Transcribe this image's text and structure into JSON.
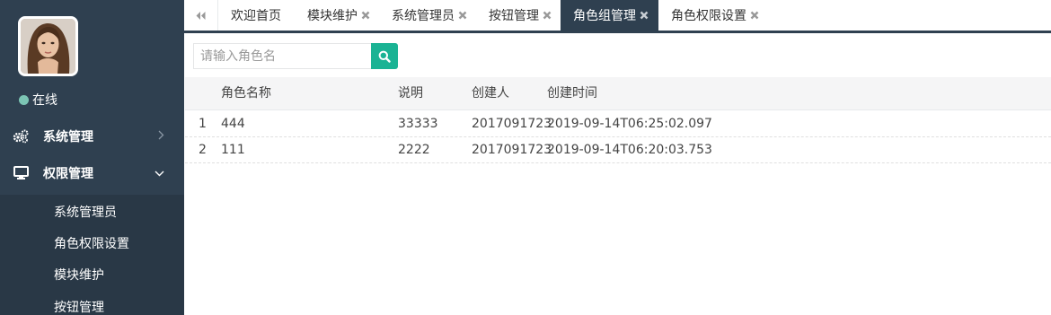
{
  "sidebar": {
    "status": "在线",
    "menu": [
      {
        "label": "系统管理",
        "icon": "cogs-icon"
      },
      {
        "label": "权限管理",
        "icon": "desktop-icon"
      }
    ],
    "submenu": [
      "系统管理员",
      "角色权限设置",
      "模块维护",
      "按钮管理"
    ]
  },
  "tabs": [
    {
      "label": "欢迎首页",
      "closable": false
    },
    {
      "label": "模块维护",
      "closable": true
    },
    {
      "label": "系统管理员",
      "closable": true
    },
    {
      "label": "按钮管理",
      "closable": true
    },
    {
      "label": "角色组管理",
      "closable": true,
      "active": true
    },
    {
      "label": "角色权限设置",
      "closable": true
    }
  ],
  "search": {
    "placeholder": "请输入角色名"
  },
  "table": {
    "columns": [
      "角色名称",
      "说明",
      "创建人",
      "创建时间"
    ],
    "rows": [
      {
        "index": "1",
        "name": "444",
        "desc": "33333",
        "creator": "2017091723",
        "time": "2019-09-14T06:25:02.097"
      },
      {
        "index": "2",
        "name": "111",
        "desc": "2222",
        "creator": "2017091723",
        "time": "2019-09-14T06:20:03.753"
      }
    ]
  },
  "colors": {
    "sidebar": "#2f4050",
    "accent": "#1ab394",
    "online": "#7cc5b4"
  }
}
